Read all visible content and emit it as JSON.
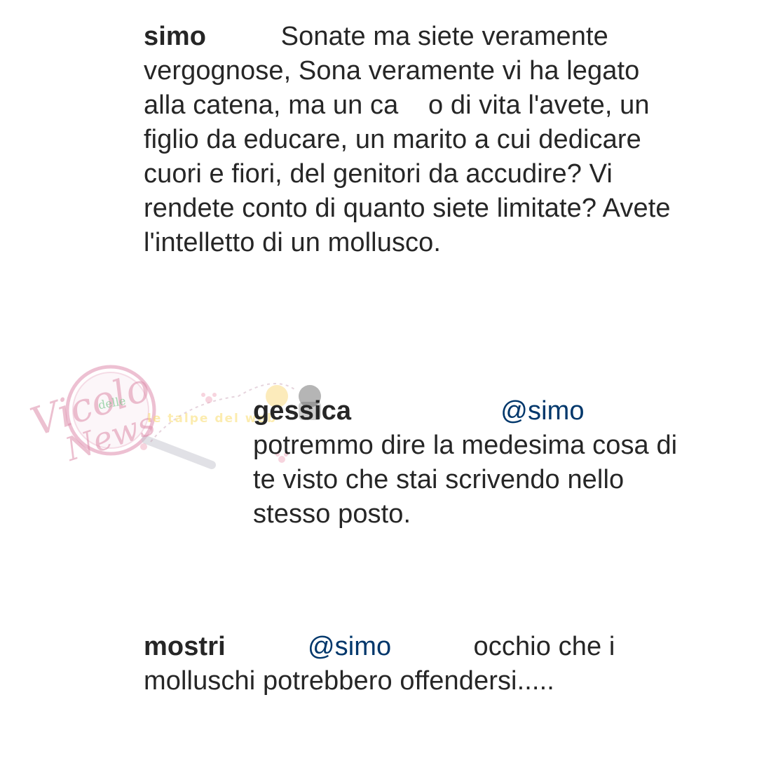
{
  "comments": [
    {
      "username": "simo",
      "gap": "          ",
      "text": "Sonate ma siete veramente vergognose, Sona veramente vi ha legato alla catena, ma un ca    o di vita l'avete, un figlio da educare, un marito a cui dedicare cuori e fiori, del genitori da accudire? Vi rendete conto di quanto siete limitate? Avete l'intelletto di un mollusco."
    },
    {
      "username": "gessica",
      "gap": "                    ",
      "mention": "@simo",
      "text": "potremmo dire la medesima cosa di te visto che stai scrivendo nello stesso posto."
    },
    {
      "username": "mostri",
      "gap": "           ",
      "mention": "@simo",
      "gap2": "           ",
      "text": "occhio che i molluschi potrebbero offendersi....."
    }
  ],
  "watermark": {
    "title_part1": "Vicolo",
    "title_small": "delle",
    "title_part2": "News",
    "tagline": "le talpe del web"
  },
  "colors": {
    "text": "#262626",
    "mention": "#00376b",
    "watermark_pink": "#dc8caa"
  }
}
